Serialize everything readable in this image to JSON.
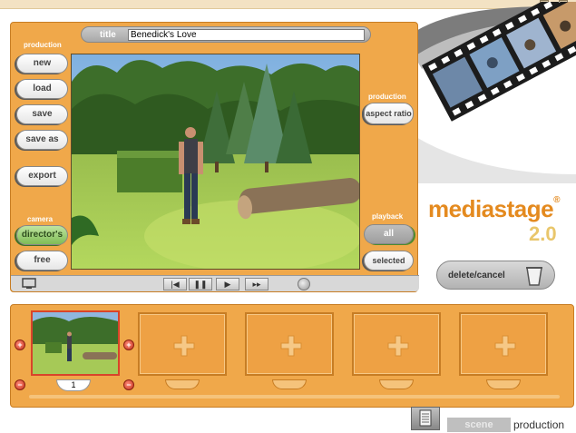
{
  "app": {
    "brand": "mediastage",
    "version": "2.0"
  },
  "title_bar": {
    "label": "title",
    "value": "Benedick's Love"
  },
  "left_panel": {
    "production_heading": "production",
    "buttons": [
      "new",
      "load",
      "save",
      "save as",
      "export"
    ],
    "camera_heading": "camera",
    "camera_buttons": [
      "director's",
      "free"
    ]
  },
  "right_panel": {
    "production_heading": "production",
    "aspect_ratio": "aspect ratio",
    "playback_heading": "playback",
    "playback_buttons": [
      "all",
      "selected"
    ]
  },
  "delete_button": {
    "label": "delete/cancel"
  },
  "timeline": {
    "selected_scene_number": "1",
    "slot_count": 5
  },
  "bottom_tabs": {
    "scene": "scene",
    "production": "production"
  },
  "colors": {
    "panel": "#f0a84a",
    "brand": "#e48a1f",
    "brand_version": "#e9c66b",
    "selected_border": "#d9442a"
  }
}
